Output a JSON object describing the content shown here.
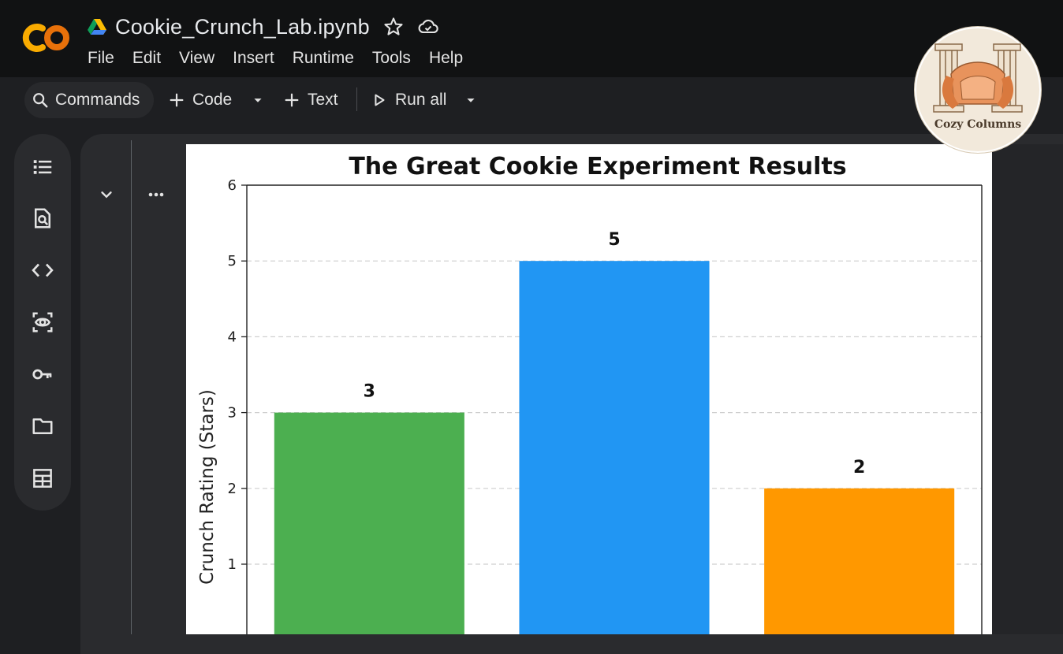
{
  "app": {
    "doc_title": "Cookie_Crunch_Lab.ipynb",
    "menu": [
      "File",
      "Edit",
      "View",
      "Insert",
      "Runtime",
      "Tools",
      "Help"
    ]
  },
  "toolbar": {
    "commands_label": "Commands",
    "code_label": "Code",
    "text_label": "Text",
    "run_all_label": "Run all"
  },
  "icons": {
    "title": [
      "star-icon",
      "cloud-saved-icon"
    ],
    "sidebar": [
      "table-of-contents-icon",
      "find-replace-icon",
      "code-snippets-icon",
      "variables-icon",
      "secrets-key-icon",
      "files-folder-icon",
      "data-table-icon"
    ]
  },
  "badge": {
    "text": "Cozy Columns"
  },
  "colors": {
    "bar_green": "#4caf50",
    "bar_blue": "#2196f3",
    "bar_orange": "#ff9800",
    "logo_orange": "#f9ab00",
    "logo_dark_orange": "#e8710a"
  },
  "chart_data": {
    "type": "bar",
    "title": "The Great Cookie Experiment Results",
    "ylabel": "Crunch Rating (Stars)",
    "xlabel": "",
    "categories": [
      "",
      "",
      ""
    ],
    "values": [
      3,
      5,
      2
    ],
    "data_labels": [
      "3",
      "5",
      "2"
    ],
    "colors": [
      "#4caf50",
      "#2196f3",
      "#ff9800"
    ],
    "ylim": [
      0,
      6
    ],
    "yticks": [
      1,
      2,
      3,
      4,
      5,
      6
    ],
    "grid": "y-dashed"
  }
}
